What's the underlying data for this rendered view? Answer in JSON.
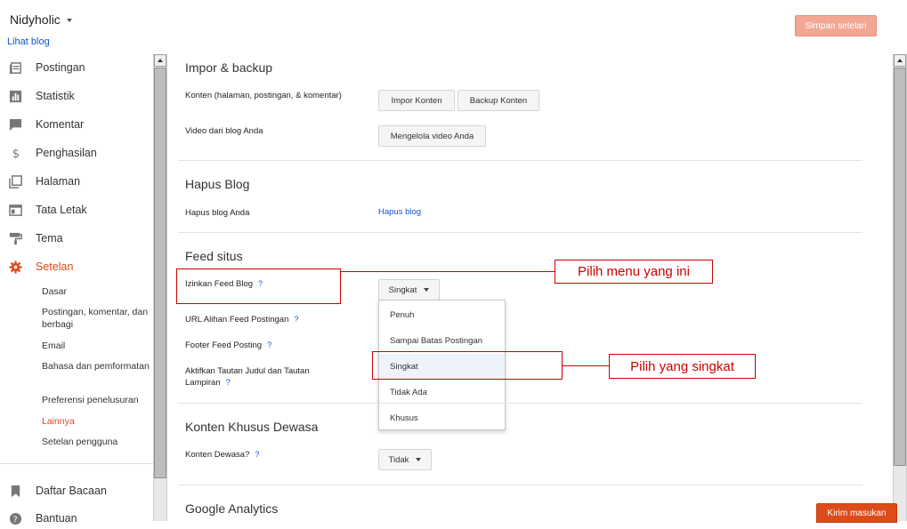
{
  "header": {
    "blog_name": "Nidyholic",
    "view_blog": "Lihat blog",
    "save_button": "Simpan setelan"
  },
  "sidebar": {
    "items": [
      {
        "label": "Postingan",
        "icon": "posts-icon"
      },
      {
        "label": "Statistik",
        "icon": "stats-icon"
      },
      {
        "label": "Komentar",
        "icon": "comment-icon"
      },
      {
        "label": "Penghasilan",
        "icon": "dollar-icon"
      },
      {
        "label": "Halaman",
        "icon": "pages-icon"
      },
      {
        "label": "Tata Letak",
        "icon": "layout-icon"
      },
      {
        "label": "Tema",
        "icon": "paint-roller-icon"
      },
      {
        "label": "Setelan",
        "icon": "gear-icon"
      }
    ],
    "subitems": [
      "Dasar",
      "Postingan, komentar, dan berbagi",
      "Email",
      "Bahasa dan pemformatan",
      "Preferensi penelusuran",
      "Lainnya",
      "Setelan pengguna"
    ],
    "bottom_items": [
      {
        "label": "Daftar Bacaan",
        "icon": "bookmark-icon"
      },
      {
        "label": "Bantuan",
        "icon": "help-icon"
      }
    ],
    "active_color": "#dd4b1a"
  },
  "main": {
    "import_backup": {
      "title": "Impor & backup",
      "content_label": "Konten (halaman, postingan, & komentar)",
      "import_button": "Impor Konten",
      "backup_button": "Backup Konten",
      "video_label": "Video dari blog Anda",
      "video_button": "Mengelola video Anda"
    },
    "delete_blog": {
      "title": "Hapus Blog",
      "label": "Hapus blog Anda",
      "link": "Hapus blog"
    },
    "site_feed": {
      "title": "Feed situs",
      "allow_feed_label": "Izinkan Feed Blog",
      "allow_feed_value": "Singkat",
      "redirect_url_label": "URL Alihan Feed Postingan",
      "footer_label": "Footer Feed Posting",
      "title_links_label": "Aktifkan Tautan Judul dan Tautan Lampiran",
      "help_mark": "?",
      "options": [
        "Penuh",
        "Sampai Batas Postingan",
        "Singkat",
        "Tidak Ada",
        "Khusus"
      ]
    },
    "adult_content": {
      "title": "Konten Khusus Dewasa",
      "label": "Konten Dewasa?",
      "value": "Tidak"
    },
    "analytics": {
      "title": "Google Analytics"
    }
  },
  "annotations": {
    "choose_menu": "Pilih menu yang ini",
    "choose_short": "Pilih yang singkat",
    "color": "#cc0000"
  },
  "feedback_button": "Kirim masukan"
}
